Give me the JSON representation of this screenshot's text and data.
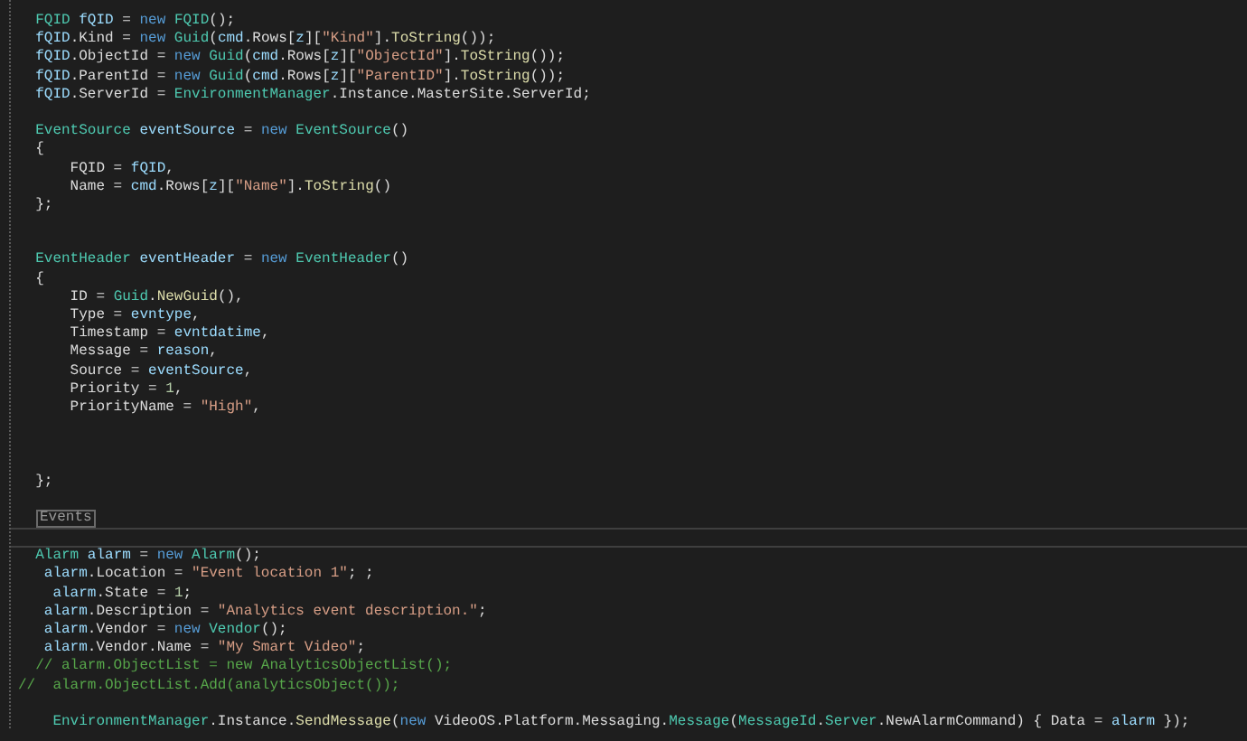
{
  "editor": {
    "lines": [
      {
        "kind": "code",
        "tokens": [
          {
            "kind": "type",
            "text": "  FQID"
          },
          {
            "kind": "variable",
            "text": " fQID"
          },
          {
            "kind": "plain",
            "text": " = "
          },
          {
            "kind": "keyword",
            "text": "new"
          },
          {
            "kind": "type",
            "text": " FQID"
          },
          {
            "kind": "plain",
            "text": "();"
          }
        ]
      },
      {
        "kind": "code",
        "tokens": [
          {
            "kind": "variable",
            "text": "  fQID"
          },
          {
            "kind": "plain",
            "text": ".Kind = "
          },
          {
            "kind": "keyword",
            "text": "new"
          },
          {
            "kind": "type",
            "text": " Guid"
          },
          {
            "kind": "plain",
            "text": "("
          },
          {
            "kind": "variable",
            "text": "cmd"
          },
          {
            "kind": "plain",
            "text": ".Rows["
          },
          {
            "kind": "variable",
            "text": "z"
          },
          {
            "kind": "plain",
            "text": "]["
          },
          {
            "kind": "string",
            "text": "\"Kind\""
          },
          {
            "kind": "plain",
            "text": "]."
          },
          {
            "kind": "method",
            "text": "ToString"
          },
          {
            "kind": "plain",
            "text": "());"
          }
        ]
      },
      {
        "kind": "code",
        "tokens": [
          {
            "kind": "variable",
            "text": "  fQID"
          },
          {
            "kind": "plain",
            "text": ".ObjectId = "
          },
          {
            "kind": "keyword",
            "text": "new"
          },
          {
            "kind": "type",
            "text": " Guid"
          },
          {
            "kind": "plain",
            "text": "("
          },
          {
            "kind": "variable",
            "text": "cmd"
          },
          {
            "kind": "plain",
            "text": ".Rows["
          },
          {
            "kind": "variable",
            "text": "z"
          },
          {
            "kind": "plain",
            "text": "]["
          },
          {
            "kind": "string",
            "text": "\"ObjectId\""
          },
          {
            "kind": "plain",
            "text": "]."
          },
          {
            "kind": "method",
            "text": "ToString"
          },
          {
            "kind": "plain",
            "text": "());"
          }
        ]
      },
      {
        "kind": "code",
        "tokens": [
          {
            "kind": "variable",
            "text": "  fQID"
          },
          {
            "kind": "plain",
            "text": ".ParentId = "
          },
          {
            "kind": "keyword",
            "text": "new"
          },
          {
            "kind": "type",
            "text": " Guid"
          },
          {
            "kind": "plain",
            "text": "("
          },
          {
            "kind": "variable",
            "text": "cmd"
          },
          {
            "kind": "plain",
            "text": ".Rows["
          },
          {
            "kind": "variable",
            "text": "z"
          },
          {
            "kind": "plain",
            "text": "]["
          },
          {
            "kind": "string",
            "text": "\"ParentID\""
          },
          {
            "kind": "plain",
            "text": "]."
          },
          {
            "kind": "method",
            "text": "ToString"
          },
          {
            "kind": "plain",
            "text": "());"
          }
        ]
      },
      {
        "kind": "code",
        "tokens": [
          {
            "kind": "variable",
            "text": "  fQID"
          },
          {
            "kind": "plain",
            "text": ".ServerId = "
          },
          {
            "kind": "type",
            "text": "EnvironmentManager"
          },
          {
            "kind": "plain",
            "text": ".Instance.MasterSite.ServerId;"
          }
        ]
      },
      {
        "kind": "blank"
      },
      {
        "kind": "code",
        "tokens": [
          {
            "kind": "type",
            "text": "  EventSource"
          },
          {
            "kind": "variable",
            "text": " eventSource"
          },
          {
            "kind": "plain",
            "text": " = "
          },
          {
            "kind": "keyword",
            "text": "new"
          },
          {
            "kind": "type",
            "text": " EventSource"
          },
          {
            "kind": "plain",
            "text": "()"
          }
        ]
      },
      {
        "kind": "code",
        "tokens": [
          {
            "kind": "plain",
            "text": "  {"
          }
        ]
      },
      {
        "kind": "code",
        "tokens": [
          {
            "kind": "plain",
            "text": "      FQID = "
          },
          {
            "kind": "variable",
            "text": "fQID"
          },
          {
            "kind": "plain",
            "text": ","
          }
        ]
      },
      {
        "kind": "code",
        "tokens": [
          {
            "kind": "plain",
            "text": "      Name = "
          },
          {
            "kind": "variable",
            "text": "cmd"
          },
          {
            "kind": "plain",
            "text": ".Rows["
          },
          {
            "kind": "variable",
            "text": "z"
          },
          {
            "kind": "plain",
            "text": "]["
          },
          {
            "kind": "string",
            "text": "\"Name\""
          },
          {
            "kind": "plain",
            "text": "]."
          },
          {
            "kind": "method",
            "text": "ToString"
          },
          {
            "kind": "plain",
            "text": "()"
          }
        ]
      },
      {
        "kind": "code",
        "tokens": [
          {
            "kind": "plain",
            "text": "  };"
          }
        ]
      },
      {
        "kind": "blank"
      },
      {
        "kind": "blank"
      },
      {
        "kind": "code",
        "tokens": [
          {
            "kind": "type",
            "text": "  EventHeader"
          },
          {
            "kind": "variable",
            "text": " eventHeader"
          },
          {
            "kind": "plain",
            "text": " = "
          },
          {
            "kind": "keyword",
            "text": "new"
          },
          {
            "kind": "type",
            "text": " EventHeader"
          },
          {
            "kind": "plain",
            "text": "()"
          }
        ]
      },
      {
        "kind": "code",
        "tokens": [
          {
            "kind": "plain",
            "text": "  {"
          }
        ]
      },
      {
        "kind": "code",
        "tokens": [
          {
            "kind": "plain",
            "text": "      ID = "
          },
          {
            "kind": "type",
            "text": "Guid"
          },
          {
            "kind": "plain",
            "text": "."
          },
          {
            "kind": "method",
            "text": "NewGuid"
          },
          {
            "kind": "plain",
            "text": "(),"
          }
        ]
      },
      {
        "kind": "code",
        "tokens": [
          {
            "kind": "plain",
            "text": "      Type = "
          },
          {
            "kind": "variable",
            "text": "evntype"
          },
          {
            "kind": "plain",
            "text": ","
          }
        ]
      },
      {
        "kind": "code",
        "tokens": [
          {
            "kind": "plain",
            "text": "      Timestamp = "
          },
          {
            "kind": "variable",
            "text": "evntdatime"
          },
          {
            "kind": "plain",
            "text": ","
          }
        ]
      },
      {
        "kind": "code",
        "tokens": [
          {
            "kind": "plain",
            "text": "      Message = "
          },
          {
            "kind": "variable",
            "text": "reason"
          },
          {
            "kind": "plain",
            "text": ","
          }
        ]
      },
      {
        "kind": "code",
        "tokens": [
          {
            "kind": "plain",
            "text": "      Source = "
          },
          {
            "kind": "variable",
            "text": "eventSource"
          },
          {
            "kind": "plain",
            "text": ","
          }
        ]
      },
      {
        "kind": "code",
        "tokens": [
          {
            "kind": "plain",
            "text": "      Priority = "
          },
          {
            "kind": "number",
            "text": "1"
          },
          {
            "kind": "plain",
            "text": ","
          }
        ]
      },
      {
        "kind": "code",
        "tokens": [
          {
            "kind": "plain",
            "text": "      PriorityName = "
          },
          {
            "kind": "string",
            "text": "\"High\""
          },
          {
            "kind": "plain",
            "text": ","
          }
        ]
      },
      {
        "kind": "blank"
      },
      {
        "kind": "blank"
      },
      {
        "kind": "blank"
      },
      {
        "kind": "code",
        "tokens": [
          {
            "kind": "plain",
            "text": "  };"
          }
        ]
      },
      {
        "kind": "blank"
      },
      {
        "kind": "region",
        "text": "Events"
      },
      {
        "kind": "separator"
      },
      {
        "kind": "code",
        "tokens": [
          {
            "kind": "type",
            "text": "  Alarm"
          },
          {
            "kind": "variable",
            "text": " alarm"
          },
          {
            "kind": "plain",
            "text": " = "
          },
          {
            "kind": "keyword",
            "text": "new"
          },
          {
            "kind": "type",
            "text": " Alarm"
          },
          {
            "kind": "plain",
            "text": "();"
          }
        ]
      },
      {
        "kind": "code",
        "tokens": [
          {
            "kind": "variable",
            "text": "   alarm"
          },
          {
            "kind": "plain",
            "text": ".Location = "
          },
          {
            "kind": "string",
            "text": "\"Event location 1\""
          },
          {
            "kind": "plain",
            "text": "; ;"
          }
        ]
      },
      {
        "kind": "code",
        "tokens": [
          {
            "kind": "variable",
            "text": "    alarm"
          },
          {
            "kind": "plain",
            "text": ".State = "
          },
          {
            "kind": "number",
            "text": "1"
          },
          {
            "kind": "plain",
            "text": ";"
          }
        ]
      },
      {
        "kind": "code",
        "tokens": [
          {
            "kind": "variable",
            "text": "   alarm"
          },
          {
            "kind": "plain",
            "text": ".Description = "
          },
          {
            "kind": "string",
            "text": "\"Analytics event description.\""
          },
          {
            "kind": "plain",
            "text": ";"
          }
        ]
      },
      {
        "kind": "code",
        "tokens": [
          {
            "kind": "variable",
            "text": "   alarm"
          },
          {
            "kind": "plain",
            "text": ".Vendor = "
          },
          {
            "kind": "keyword",
            "text": "new"
          },
          {
            "kind": "type",
            "text": " Vendor"
          },
          {
            "kind": "plain",
            "text": "();"
          }
        ]
      },
      {
        "kind": "code",
        "tokens": [
          {
            "kind": "variable",
            "text": "   alarm"
          },
          {
            "kind": "plain",
            "text": ".Vendor.Name = "
          },
          {
            "kind": "string",
            "text": "\"My Smart Video\""
          },
          {
            "kind": "plain",
            "text": ";"
          }
        ]
      },
      {
        "kind": "code",
        "tokens": [
          {
            "kind": "comment",
            "text": "  // alarm.ObjectList = new AnalyticsObjectList();"
          }
        ]
      },
      {
        "kind": "code",
        "tokens": [
          {
            "kind": "comment",
            "text": "//  alarm.ObjectList.Add(analyticsObject());"
          }
        ]
      },
      {
        "kind": "blank"
      },
      {
        "kind": "code",
        "tokens": [
          {
            "kind": "type",
            "text": "    EnvironmentManager"
          },
          {
            "kind": "plain",
            "text": ".Instance."
          },
          {
            "kind": "method",
            "text": "SendMessage"
          },
          {
            "kind": "plain",
            "text": "("
          },
          {
            "kind": "keyword",
            "text": "new"
          },
          {
            "kind": "plain",
            "text": " VideoOS.Platform.Messaging."
          },
          {
            "kind": "type",
            "text": "Message"
          },
          {
            "kind": "plain",
            "text": "("
          },
          {
            "kind": "type",
            "text": "MessageId"
          },
          {
            "kind": "plain",
            "text": "."
          },
          {
            "kind": "type",
            "text": "Server"
          },
          {
            "kind": "plain",
            "text": ".NewAlarmCommand) { Data = "
          },
          {
            "kind": "variable",
            "text": "alarm"
          },
          {
            "kind": "plain",
            "text": " });"
          }
        ]
      }
    ]
  }
}
